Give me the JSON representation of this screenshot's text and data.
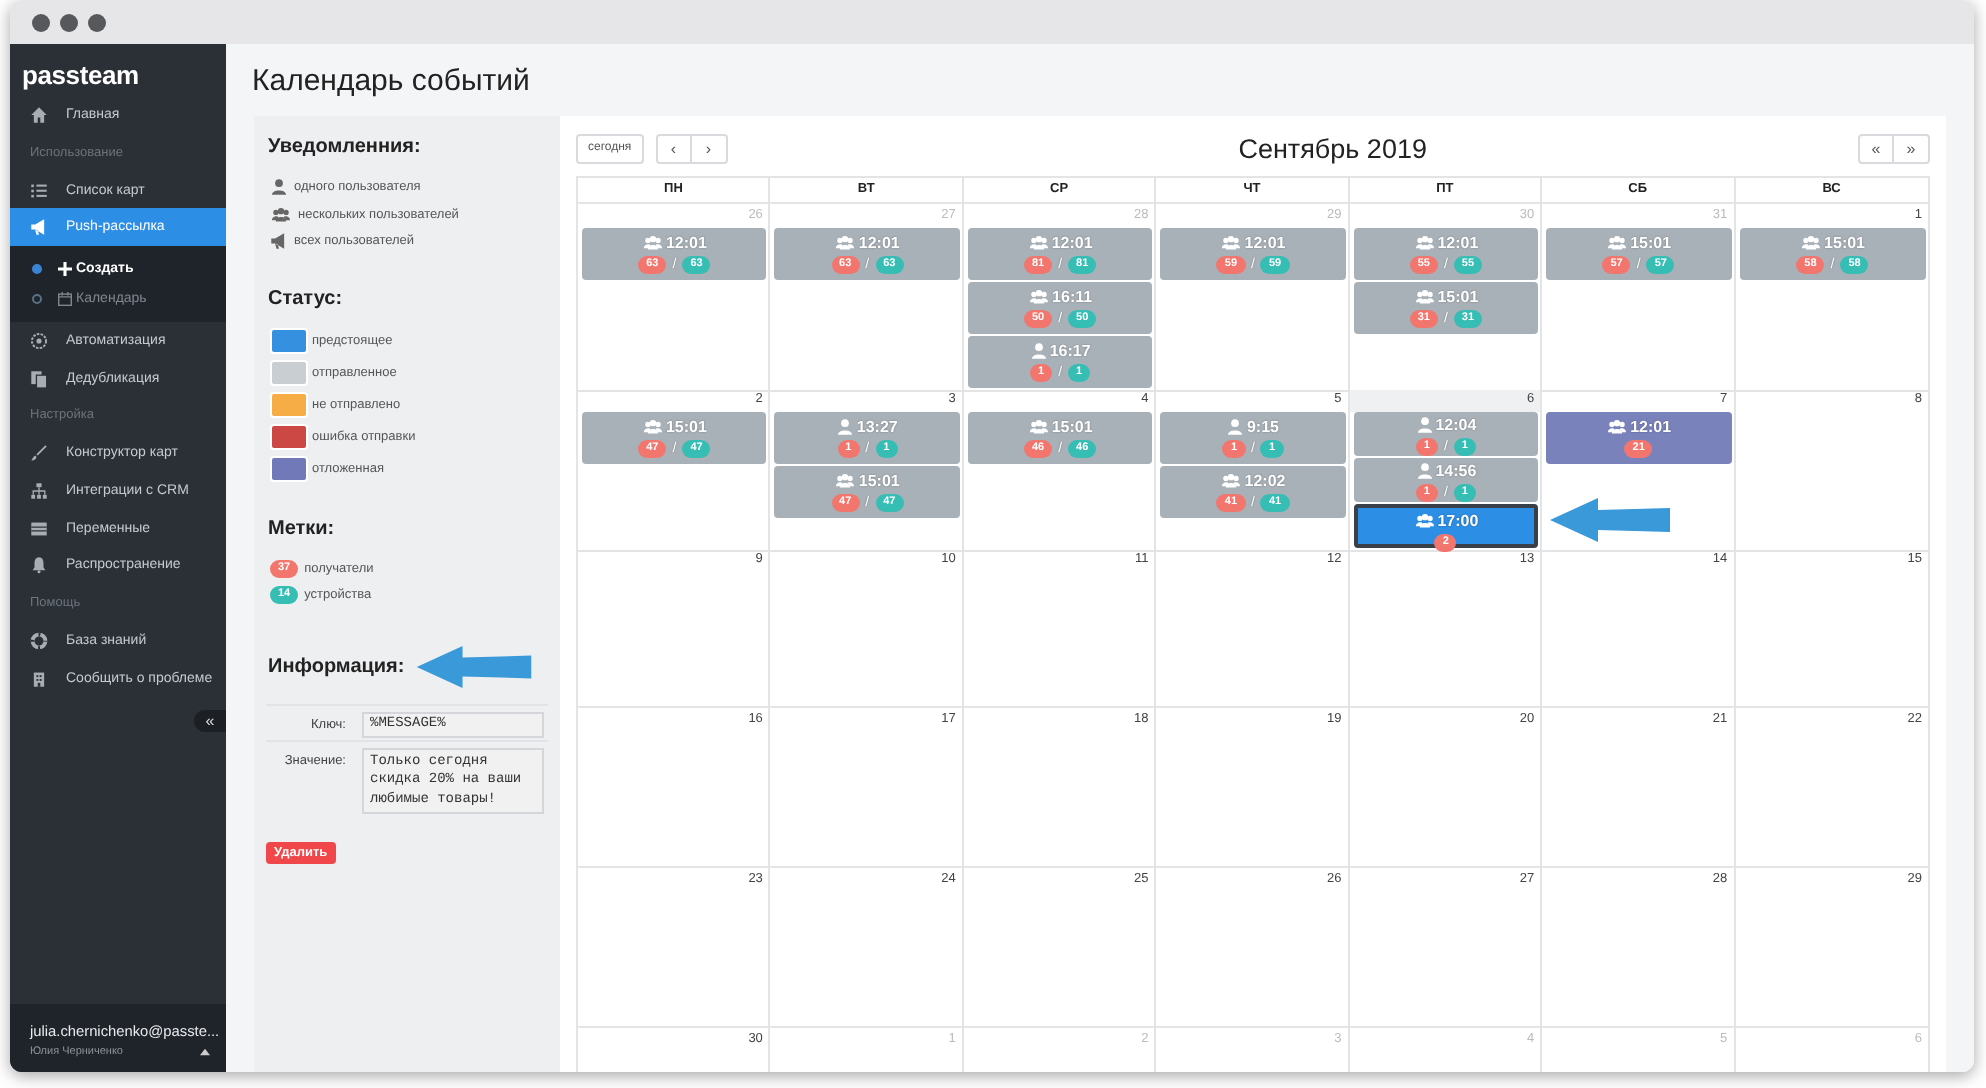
{
  "sidebar": {
    "logo": "passteam",
    "items": [
      {
        "kind": "link",
        "label": "Главная",
        "selected": false
      },
      {
        "kind": "section",
        "label": "Использование"
      },
      {
        "kind": "link",
        "label": "Список карт",
        "selected": false
      },
      {
        "kind": "link",
        "label": "Push-рассылка",
        "selected": true,
        "children": [
          {
            "label": "Создать",
            "selected": true
          },
          {
            "label": "Календарь",
            "selected": false
          }
        ]
      },
      {
        "kind": "link",
        "label": "Автоматизация",
        "selected": false
      },
      {
        "kind": "link",
        "label": "Дедубликация",
        "selected": false
      },
      {
        "kind": "section",
        "label": "Настройка"
      },
      {
        "kind": "link",
        "label": "Конструктор карт",
        "selected": false
      },
      {
        "kind": "link",
        "label": "Интеграции с CRM",
        "selected": false
      },
      {
        "kind": "link",
        "label": "Переменные",
        "selected": false
      },
      {
        "kind": "link",
        "label": "Распространение",
        "selected": false
      },
      {
        "kind": "section",
        "label": "Помощь"
      },
      {
        "kind": "link",
        "label": "База знаний",
        "selected": false
      },
      {
        "kind": "link",
        "label": "Сообщить о проблеме",
        "selected": false
      }
    ],
    "collapse": "«",
    "user": {
      "email": "julia.chernichenko@passte...",
      "name": "Юлия Черниченко"
    }
  },
  "page_title": "Календарь событий",
  "legend": {
    "notifications": {
      "title": "Уведомленния:",
      "items": [
        {
          "kind": "single",
          "label": "одного пользователя"
        },
        {
          "kind": "multi",
          "label": "нескольких пользователей"
        },
        {
          "kind": "all",
          "label": "всех пользователей"
        }
      ]
    },
    "status": {
      "title": "Статус:",
      "items": [
        {
          "label": "предстоящее",
          "color": "#3590e0"
        },
        {
          "label": "отправленное",
          "color": "#c9ced3"
        },
        {
          "label": "не отправлено",
          "color": "#f6ad45"
        },
        {
          "label": "ошибка отправки",
          "color": "#cc4845"
        },
        {
          "label": "отложенная",
          "color": "#7279b8"
        }
      ]
    },
    "tags": {
      "title": "Метки:",
      "items": [
        {
          "kind": "recipients",
          "count": "37",
          "label": "получатели"
        },
        {
          "kind": "devices",
          "count": "14",
          "label": "устройства"
        }
      ]
    },
    "info": {
      "title": "Информация:",
      "key_label": "Ключ:",
      "key_value": "%MESSAGE%",
      "value_label": "Значение:",
      "value": "Только сегодня скидка 20% на ваши любимые товары!",
      "delete_button": "Удалить"
    }
  },
  "calendar": {
    "today_button": "сегодня",
    "prev": "‹",
    "next": "›",
    "title": "Сентябрь 2019",
    "prev_year": "«",
    "next_year": "»",
    "weekdays": [
      "ПН",
      "ВТ",
      "СР",
      "ЧТ",
      "ПТ",
      "СБ",
      "ВС"
    ],
    "weeks": [
      [
        {
          "day": "26",
          "other_month": true,
          "today": false,
          "events": [
            {
              "kind": "multi",
              "time": "12:01",
              "color": "#a9b1b8",
              "selected": false,
              "recipients": "63",
              "separator": "/",
              "devices": "63"
            }
          ]
        },
        {
          "day": "27",
          "other_month": true,
          "today": false,
          "events": [
            {
              "kind": "multi",
              "time": "12:01",
              "color": "#a9b1b8",
              "selected": false,
              "recipients": "63",
              "separator": "/",
              "devices": "63"
            }
          ]
        },
        {
          "day": "28",
          "other_month": true,
          "today": false,
          "events": [
            {
              "kind": "multi",
              "time": "12:01",
              "color": "#a9b1b8",
              "selected": false,
              "recipients": "81",
              "separator": "/",
              "devices": "81"
            },
            {
              "kind": "multi",
              "time": "16:11",
              "color": "#a9b1b8",
              "selected": false,
              "recipients": "50",
              "separator": "/",
              "devices": "50"
            },
            {
              "kind": "single",
              "time": "16:17",
              "color": "#a9b1b8",
              "selected": false,
              "recipients": "1",
              "separator": "/",
              "devices": "1"
            }
          ]
        },
        {
          "day": "29",
          "other_month": true,
          "today": false,
          "events": [
            {
              "kind": "multi",
              "time": "12:01",
              "color": "#a9b1b8",
              "selected": false,
              "recipients": "59",
              "separator": "/",
              "devices": "59"
            }
          ]
        },
        {
          "day": "30",
          "other_month": true,
          "today": false,
          "events": [
            {
              "kind": "multi",
              "time": "12:01",
              "color": "#a9b1b8",
              "selected": false,
              "recipients": "55",
              "separator": "/",
              "devices": "55"
            },
            {
              "kind": "multi",
              "time": "15:01",
              "color": "#a9b1b8",
              "selected": false,
              "recipients": "31",
              "separator": "/",
              "devices": "31"
            }
          ]
        },
        {
          "day": "31",
          "other_month": true,
          "today": false,
          "events": [
            {
              "kind": "multi",
              "time": "15:01",
              "color": "#a9b1b8",
              "selected": false,
              "recipients": "57",
              "separator": "/",
              "devices": "57"
            }
          ]
        },
        {
          "day": "1",
          "other_month": false,
          "today": false,
          "events": [
            {
              "kind": "multi",
              "time": "15:01",
              "color": "#a9b1b8",
              "selected": false,
              "recipients": "58",
              "separator": "/",
              "devices": "58"
            }
          ]
        }
      ],
      [
        {
          "day": "2",
          "other_month": false,
          "today": false,
          "events": [
            {
              "kind": "multi",
              "time": "15:01",
              "color": "#a9b1b8",
              "selected": false,
              "recipients": "47",
              "separator": "/",
              "devices": "47"
            }
          ]
        },
        {
          "day": "3",
          "other_month": false,
          "today": false,
          "events": [
            {
              "kind": "single",
              "time": "13:27",
              "color": "#a9b1b8",
              "selected": false,
              "recipients": "1",
              "separator": "/",
              "devices": "1"
            },
            {
              "kind": "multi",
              "time": "15:01",
              "color": "#a9b1b8",
              "selected": false,
              "recipients": "47",
              "separator": "/",
              "devices": "47"
            }
          ]
        },
        {
          "day": "4",
          "other_month": false,
          "today": false,
          "events": [
            {
              "kind": "multi",
              "time": "15:01",
              "color": "#a9b1b8",
              "selected": false,
              "recipients": "46",
              "separator": "/",
              "devices": "46"
            }
          ]
        },
        {
          "day": "5",
          "other_month": false,
          "today": false,
          "events": [
            {
              "kind": "single",
              "time": "9:15",
              "color": "#a9b1b8",
              "selected": false,
              "recipients": "1",
              "separator": "/",
              "devices": "1"
            },
            {
              "kind": "multi",
              "time": "12:02",
              "color": "#a9b1b8",
              "selected": false,
              "recipients": "41",
              "separator": "/",
              "devices": "41"
            }
          ]
        },
        {
          "day": "6",
          "other_month": false,
          "today": true,
          "events": [
            {
              "kind": "single",
              "time": "12:04",
              "color": "#a9b1b8",
              "selected": false,
              "recipients": "1",
              "separator": "/",
              "devices": "1"
            },
            {
              "kind": "single",
              "time": "14:56",
              "color": "#a9b1b8",
              "selected": false,
              "recipients": "1",
              "separator": "/",
              "devices": "1"
            },
            {
              "kind": "multi",
              "time": "17:00",
              "color": "#2d8ee6",
              "selected": true,
              "recipients": "2"
            }
          ]
        },
        {
          "day": "7",
          "other_month": false,
          "today": false,
          "events": [
            {
              "kind": "multi",
              "time": "12:01",
              "color": "#7a82bc",
              "selected": false,
              "recipients": "21"
            }
          ]
        },
        {
          "day": "8",
          "other_month": false,
          "today": false
        }
      ],
      [
        {
          "day": "9",
          "other_month": false,
          "today": false
        },
        {
          "day": "10",
          "other_month": false,
          "today": false
        },
        {
          "day": "11",
          "other_month": false,
          "today": false
        },
        {
          "day": "12",
          "other_month": false,
          "today": false
        },
        {
          "day": "13",
          "other_month": false,
          "today": false
        },
        {
          "day": "14",
          "other_month": false,
          "today": false
        },
        {
          "day": "15",
          "other_month": false,
          "today": false
        }
      ],
      [
        {
          "day": "16",
          "other_month": false,
          "today": false
        },
        {
          "day": "17",
          "other_month": false,
          "today": false
        },
        {
          "day": "18",
          "other_month": false,
          "today": false
        },
        {
          "day": "19",
          "other_month": false,
          "today": false
        },
        {
          "day": "20",
          "other_month": false,
          "today": false
        },
        {
          "day": "21",
          "other_month": false,
          "today": false
        },
        {
          "day": "22",
          "other_month": false,
          "today": false
        }
      ],
      [
        {
          "day": "23",
          "other_month": false,
          "today": false
        },
        {
          "day": "24",
          "other_month": false,
          "today": false
        },
        {
          "day": "25",
          "other_month": false,
          "today": false
        },
        {
          "day": "26",
          "other_month": false,
          "today": false
        },
        {
          "day": "27",
          "other_month": false,
          "today": false
        },
        {
          "day": "28",
          "other_month": false,
          "today": false
        },
        {
          "day": "29",
          "other_month": false,
          "today": false
        }
      ],
      [
        {
          "day": "30",
          "other_month": false,
          "today": false
        },
        {
          "day": "1",
          "other_month": true,
          "today": false
        },
        {
          "day": "2",
          "other_month": true,
          "today": false
        },
        {
          "day": "3",
          "other_month": true,
          "today": false
        },
        {
          "day": "4",
          "other_month": true,
          "today": false
        },
        {
          "day": "5",
          "other_month": true,
          "today": false
        },
        {
          "day": "6",
          "other_month": true,
          "today": false
        }
      ]
    ]
  }
}
